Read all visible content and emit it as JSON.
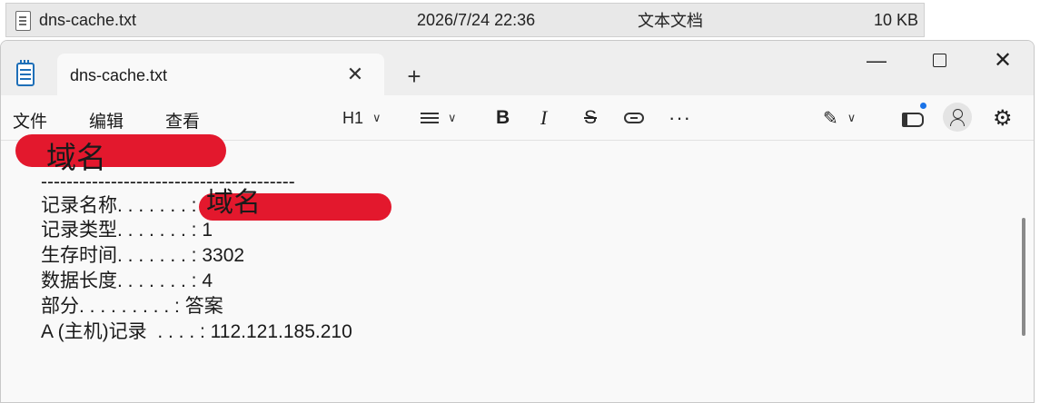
{
  "explorer_row": {
    "file_name": "dns-cache.txt",
    "modified": "2026/7/24 22:36",
    "type": "文本文档",
    "size": "10 KB"
  },
  "window": {
    "tab_title": "dns-cache.txt",
    "tab_close": "✕",
    "new_tab": "+",
    "minimize": "—",
    "close": "✕"
  },
  "menu": {
    "file": "文件",
    "edit": "编辑",
    "view": "查看"
  },
  "toolbar": {
    "heading": "H1",
    "chevron": "∨",
    "bold": "B",
    "italic": "I",
    "strike": "S",
    "more": "···",
    "copilot": "✎",
    "settings": "⚙"
  },
  "document": {
    "heading": "域名",
    "separator": "----------------------------------------",
    "record_name_label": "记录名称. . . . . . . :",
    "record_name_value": "域名",
    "record_type": "记录类型. . . . . . . : 1",
    "ttl": "生存时间. . . . . . . : 3302",
    "data_length": "数据长度. . . . . . . : 4",
    "section": "部分. . . . . . . . . : 答案",
    "a_record": "A (主机)记录  . . . . : 112.121.185.210"
  },
  "colors": {
    "redaction": "#e3182d",
    "accent": "#1a73e8"
  }
}
